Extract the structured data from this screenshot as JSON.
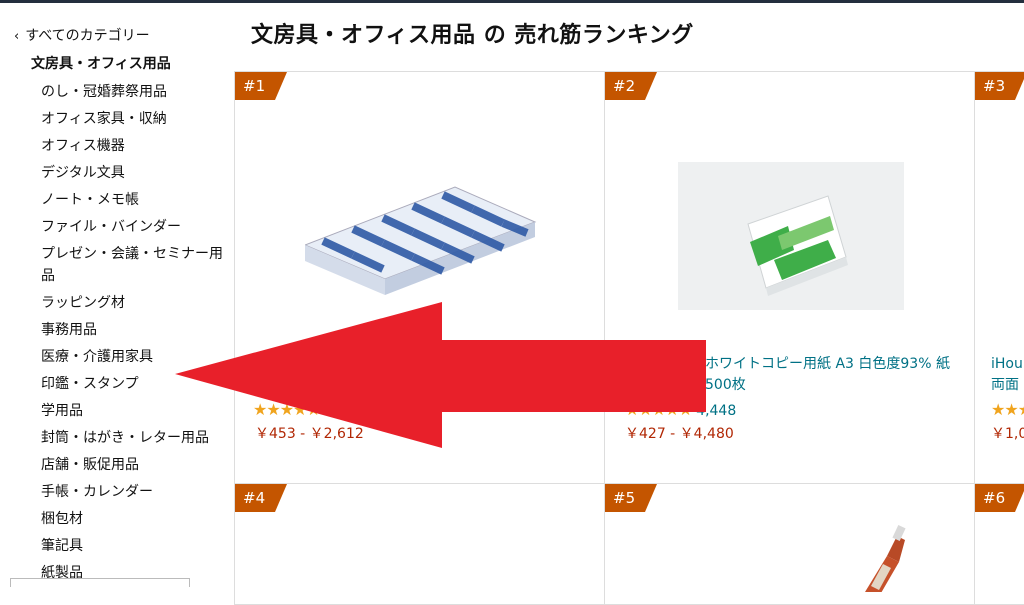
{
  "sidebar": {
    "all_categories": "すべてのカテゴリー",
    "current_category": "文房具・オフィス用品",
    "items": [
      "のし・冠婚葬祭用品",
      "オフィス家具・収納",
      "オフィス機器",
      "デジタル文具",
      "ノート・メモ帳",
      "ファイル・バインダー",
      "プレゼン・会議・セミナー用品",
      "ラッピング材",
      "事務用品",
      "医療・介護用家具",
      "印鑑・スタンプ",
      "学用品",
      "封筒・はがき・レター用品",
      "店舗・販促用品",
      "手帳・カレンダー",
      "梱包材",
      "筆記具",
      "紙製品"
    ]
  },
  "main": {
    "title": "文房具・オフィス用品 の 売れ筋ランキング",
    "products": [
      {
        "rank": "#1",
        "title": "",
        "rating_count": "",
        "price": "￥453 - ￥2,612"
      },
      {
        "rank": "#2",
        "title": "ホワイトコピー用紙 A3 白色度93% 紙",
        "title_line2": "500枚",
        "rating_count": "4,448",
        "price": "￥427 - ￥4,480"
      },
      {
        "rank": "#3",
        "title": "iHou",
        "title_line2": "両面",
        "rating_count": "",
        "price": "￥1,0"
      },
      {
        "rank": "#4"
      },
      {
        "rank": "#5"
      },
      {
        "rank": "#6"
      }
    ]
  },
  "colors": {
    "badge": "#c45500",
    "link": "#007185",
    "price": "#b12704",
    "star": "#f0a41e",
    "arrow": "#e8202a"
  }
}
